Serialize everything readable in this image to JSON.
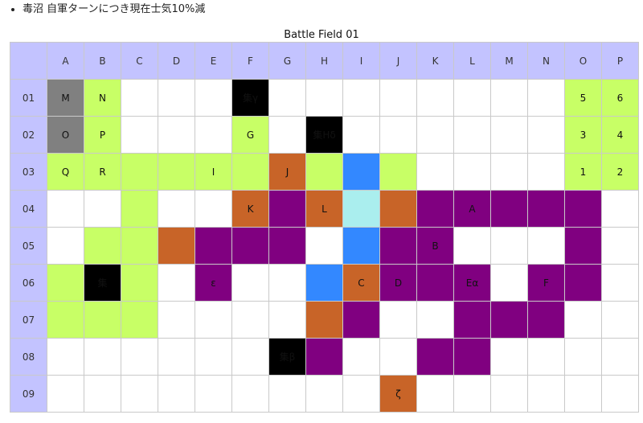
{
  "note": "毒沼 自軍ターンにつき現在士気10%減",
  "caption": "Battle Field 01",
  "columns": [
    "A",
    "B",
    "C",
    "D",
    "E",
    "F",
    "G",
    "H",
    "I",
    "J",
    "K",
    "L",
    "M",
    "N",
    "O",
    "P"
  ],
  "colors": {
    "grass": "#c8ff66",
    "rock": "#808080",
    "black": "#000000",
    "orange": "#c86428",
    "purple": "#800080",
    "blue": "#3388ff",
    "cyan": "#aaeeee",
    "empty": "#ffffff",
    "header": "#c3c3ff"
  },
  "rows": [
    {
      "label": "01",
      "cells": [
        [
          "A",
          "M"
        ],
        [
          "G",
          "N"
        ],
        [
          "W",
          ""
        ],
        [
          "W",
          ""
        ],
        [
          "W",
          ""
        ],
        [
          "K",
          "集γ"
        ],
        [
          "W",
          ""
        ],
        [
          "W",
          ""
        ],
        [
          "W",
          ""
        ],
        [
          "W",
          ""
        ],
        [
          "W",
          ""
        ],
        [
          "W",
          ""
        ],
        [
          "W",
          ""
        ],
        [
          "W",
          ""
        ],
        [
          "G",
          "5"
        ],
        [
          "G",
          "6"
        ]
      ]
    },
    {
      "label": "02",
      "cells": [
        [
          "A",
          "O"
        ],
        [
          "G",
          "P"
        ],
        [
          "W",
          ""
        ],
        [
          "W",
          ""
        ],
        [
          "W",
          ""
        ],
        [
          "G",
          "G"
        ],
        [
          "W",
          ""
        ],
        [
          "K",
          "集Hδ"
        ],
        [
          "W",
          ""
        ],
        [
          "W",
          ""
        ],
        [
          "W",
          ""
        ],
        [
          "W",
          ""
        ],
        [
          "W",
          ""
        ],
        [
          "W",
          ""
        ],
        [
          "G",
          "3"
        ],
        [
          "G",
          "4"
        ]
      ]
    },
    {
      "label": "03",
      "cells": [
        [
          "G",
          "Q"
        ],
        [
          "G",
          "R"
        ],
        [
          "G",
          ""
        ],
        [
          "G",
          ""
        ],
        [
          "G",
          "I"
        ],
        [
          "G",
          ""
        ],
        [
          "O",
          "J"
        ],
        [
          "G",
          ""
        ],
        [
          "B",
          ""
        ],
        [
          "G",
          ""
        ],
        [
          "W",
          ""
        ],
        [
          "W",
          ""
        ],
        [
          "W",
          ""
        ],
        [
          "W",
          ""
        ],
        [
          "G",
          "1"
        ],
        [
          "G",
          "2"
        ]
      ]
    },
    {
      "label": "04",
      "cells": [
        [
          "W",
          ""
        ],
        [
          "W",
          ""
        ],
        [
          "G",
          ""
        ],
        [
          "W",
          ""
        ],
        [
          "W",
          ""
        ],
        [
          "O",
          "K"
        ],
        [
          "P",
          ""
        ],
        [
          "O",
          "L"
        ],
        [
          "C",
          ""
        ],
        [
          "O",
          ""
        ],
        [
          "P",
          ""
        ],
        [
          "P",
          "A"
        ],
        [
          "P",
          ""
        ],
        [
          "P",
          ""
        ],
        [
          "P",
          ""
        ],
        [
          "W",
          ""
        ]
      ]
    },
    {
      "label": "05",
      "cells": [
        [
          "W",
          ""
        ],
        [
          "G",
          ""
        ],
        [
          "G",
          ""
        ],
        [
          "O",
          ""
        ],
        [
          "P",
          ""
        ],
        [
          "P",
          ""
        ],
        [
          "P",
          ""
        ],
        [
          "W",
          ""
        ],
        [
          "B",
          ""
        ],
        [
          "P",
          ""
        ],
        [
          "P",
          "B"
        ],
        [
          "W",
          ""
        ],
        [
          "W",
          ""
        ],
        [
          "W",
          ""
        ],
        [
          "P",
          ""
        ],
        [
          "W",
          ""
        ]
      ]
    },
    {
      "label": "06",
      "cells": [
        [
          "G",
          ""
        ],
        [
          "K",
          "集"
        ],
        [
          "G",
          ""
        ],
        [
          "W",
          ""
        ],
        [
          "P",
          "ε"
        ],
        [
          "W",
          ""
        ],
        [
          "W",
          ""
        ],
        [
          "B",
          ""
        ],
        [
          "O",
          "C"
        ],
        [
          "P",
          "D"
        ],
        [
          "P",
          ""
        ],
        [
          "P",
          "Eα"
        ],
        [
          "W",
          ""
        ],
        [
          "P",
          "F"
        ],
        [
          "P",
          ""
        ],
        [
          "W",
          ""
        ]
      ]
    },
    {
      "label": "07",
      "cells": [
        [
          "G",
          ""
        ],
        [
          "G",
          ""
        ],
        [
          "G",
          ""
        ],
        [
          "W",
          ""
        ],
        [
          "W",
          ""
        ],
        [
          "W",
          ""
        ],
        [
          "W",
          ""
        ],
        [
          "O",
          ""
        ],
        [
          "P",
          ""
        ],
        [
          "W",
          ""
        ],
        [
          "W",
          ""
        ],
        [
          "P",
          ""
        ],
        [
          "P",
          ""
        ],
        [
          "P",
          ""
        ],
        [
          "W",
          ""
        ],
        [
          "W",
          ""
        ]
      ]
    },
    {
      "label": "08",
      "cells": [
        [
          "W",
          ""
        ],
        [
          "W",
          ""
        ],
        [
          "W",
          ""
        ],
        [
          "W",
          ""
        ],
        [
          "W",
          ""
        ],
        [
          "W",
          ""
        ],
        [
          "K",
          "集β"
        ],
        [
          "P",
          ""
        ],
        [
          "W",
          ""
        ],
        [
          "W",
          ""
        ],
        [
          "P",
          ""
        ],
        [
          "P",
          ""
        ],
        [
          "W",
          ""
        ],
        [
          "W",
          ""
        ],
        [
          "W",
          ""
        ],
        [
          "W",
          ""
        ]
      ]
    },
    {
      "label": "09",
      "cells": [
        [
          "W",
          ""
        ],
        [
          "W",
          ""
        ],
        [
          "W",
          ""
        ],
        [
          "W",
          ""
        ],
        [
          "W",
          ""
        ],
        [
          "W",
          ""
        ],
        [
          "W",
          ""
        ],
        [
          "W",
          ""
        ],
        [
          "W",
          ""
        ],
        [
          "O",
          "ζ"
        ],
        [
          "W",
          ""
        ],
        [
          "W",
          ""
        ],
        [
          "W",
          ""
        ],
        [
          "W",
          ""
        ],
        [
          "W",
          ""
        ],
        [
          "W",
          ""
        ]
      ]
    }
  ]
}
